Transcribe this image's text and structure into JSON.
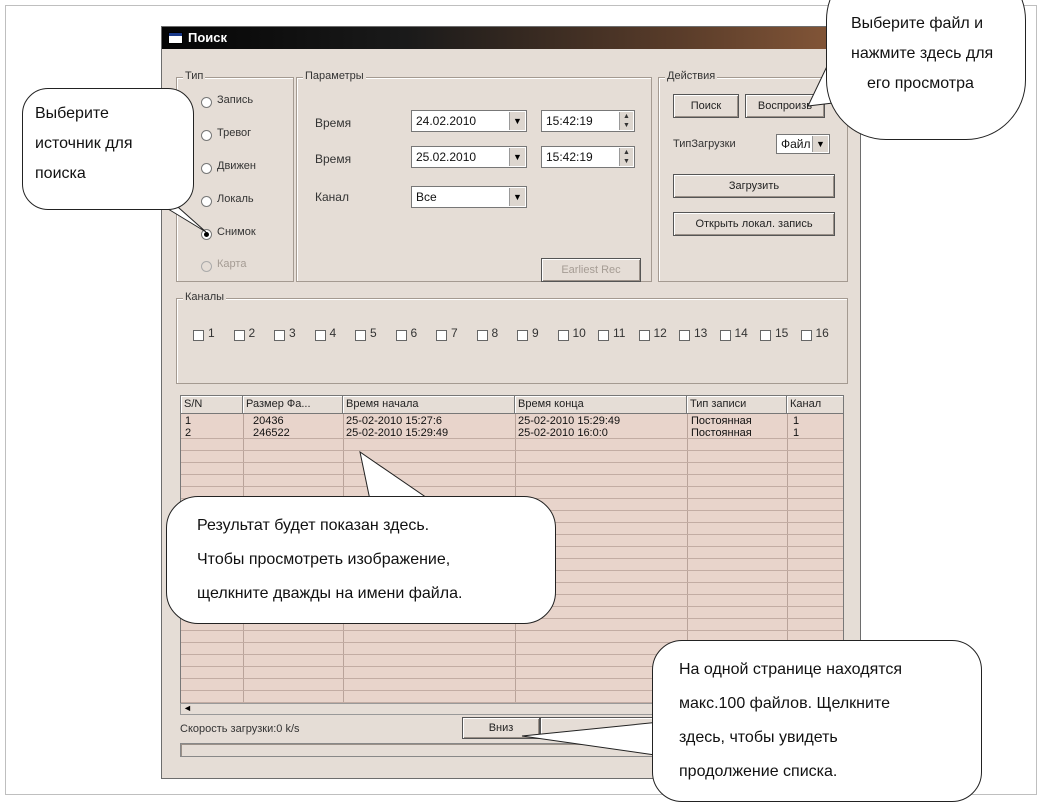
{
  "window": {
    "title": "Поиск"
  },
  "type_group": {
    "title": "Тип",
    "options": [
      {
        "label": "Запись",
        "selected": false,
        "enabled": true
      },
      {
        "label": "Тревог",
        "selected": false,
        "enabled": true
      },
      {
        "label": "Движен",
        "selected": false,
        "enabled": true
      },
      {
        "label": "Локаль",
        "selected": false,
        "enabled": true
      },
      {
        "label": "Снимок",
        "selected": true,
        "enabled": true
      },
      {
        "label": "Карта",
        "selected": false,
        "enabled": false
      }
    ]
  },
  "params": {
    "title": "Параметры",
    "time_label_1": "Время",
    "date_1": "24.02.2010",
    "clock_1": "15:42:19",
    "time_label_2": "Время",
    "date_2": "25.02.2010",
    "clock_2": "15:42:19",
    "channel_label": "Канал",
    "channel_value": "Все",
    "earliest_button": "Earliest Rec"
  },
  "actions": {
    "title": "Действия",
    "search_button": "Поиск",
    "play_button": "Воспроизв",
    "download_type_label": "ТипЗагрузки",
    "download_type_value": "Файл",
    "download_button": "Загрузить",
    "open_local_button": "Открыть локал. запись"
  },
  "channels": {
    "title": "Каналы",
    "items": [
      "1",
      "2",
      "3",
      "4",
      "5",
      "6",
      "7",
      "8",
      "9",
      "10",
      "11",
      "12",
      "13",
      "14",
      "15",
      "16"
    ]
  },
  "table": {
    "columns": [
      "S/N",
      "Размер Фа...",
      "Время начала",
      "Время конца",
      "Тип записи",
      "Канал"
    ],
    "rows": [
      [
        "1",
        "20436",
        "25-02-2010 15:27:6",
        "25-02-2010 15:29:49",
        "Постоянная",
        "1"
      ],
      [
        "2",
        "246522",
        "25-02-2010 15:29:49",
        "25-02-2010 16:0:0",
        "Постоянная",
        "1"
      ]
    ]
  },
  "status": {
    "download_speed": "Скорость загрузки:0 k/s"
  },
  "footer": {
    "next_button": "Вниз"
  },
  "callouts": {
    "source": [
      "Выберите",
      "источник для",
      "поиска"
    ],
    "play": [
      "Выберите файл и",
      "нажмите здесь для",
      "его просмотра"
    ],
    "result": [
      "Результат будет показан здесь.",
      "Чтобы просмотреть изображение,",
      "щелкните дважды на имени файла."
    ],
    "pages": [
      "На одной странице находятся",
      "макс.100 файлов. Щелкните",
      "здесь, чтобы увидеть",
      "продолжение списка."
    ]
  }
}
